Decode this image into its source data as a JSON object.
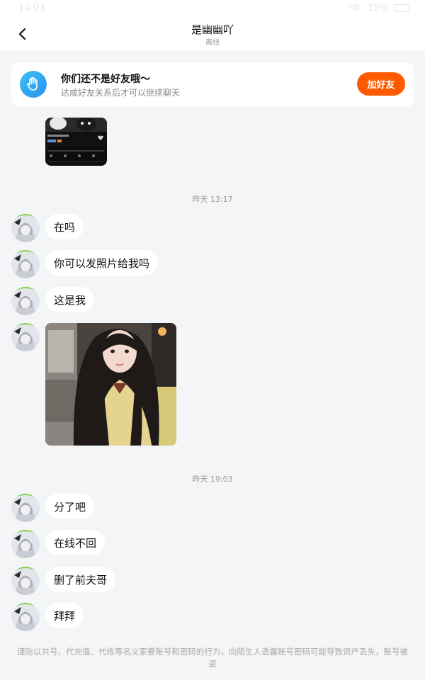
{
  "status_bar": {
    "time": "14:03",
    "battery": "15%"
  },
  "header": {
    "title": "是幽幽吖",
    "subtitle": "离线"
  },
  "friend_card": {
    "heading": "你们还不是好友哦～",
    "description": "达成好友关系后才可以继续聊天",
    "add_button": "加好友"
  },
  "chat": {
    "divider_1": "昨天 13:17",
    "messages_1": [
      "在吗",
      "你可以发照片给我吗",
      "这是我"
    ],
    "divider_2": "昨天 19:03",
    "messages_2": [
      "分了吧",
      "在线不回",
      "删了前夫哥",
      "拜拜"
    ]
  },
  "warning_text": "谨防以共号、代充值、代练等名义索要账号和密码的行为，向陌生人透露账号密码可能导致资产丢失，账号被盗",
  "colors": {
    "accent": "#ff5a00",
    "wave_icon": "#2a8ff0",
    "page_bg": "#f4f5f7"
  }
}
